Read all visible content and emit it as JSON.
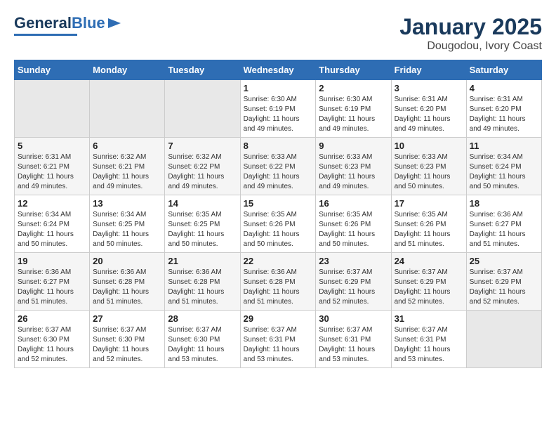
{
  "header": {
    "logo_general": "General",
    "logo_blue": "Blue",
    "title": "January 2025",
    "subtitle": "Dougodou, Ivory Coast"
  },
  "weekdays": [
    "Sunday",
    "Monday",
    "Tuesday",
    "Wednesday",
    "Thursday",
    "Friday",
    "Saturday"
  ],
  "weeks": [
    [
      {
        "day": "",
        "info": ""
      },
      {
        "day": "",
        "info": ""
      },
      {
        "day": "",
        "info": ""
      },
      {
        "day": "1",
        "info": "Sunrise: 6:30 AM\nSunset: 6:19 PM\nDaylight: 11 hours\nand 49 minutes."
      },
      {
        "day": "2",
        "info": "Sunrise: 6:30 AM\nSunset: 6:19 PM\nDaylight: 11 hours\nand 49 minutes."
      },
      {
        "day": "3",
        "info": "Sunrise: 6:31 AM\nSunset: 6:20 PM\nDaylight: 11 hours\nand 49 minutes."
      },
      {
        "day": "4",
        "info": "Sunrise: 6:31 AM\nSunset: 6:20 PM\nDaylight: 11 hours\nand 49 minutes."
      }
    ],
    [
      {
        "day": "5",
        "info": "Sunrise: 6:31 AM\nSunset: 6:21 PM\nDaylight: 11 hours\nand 49 minutes."
      },
      {
        "day": "6",
        "info": "Sunrise: 6:32 AM\nSunset: 6:21 PM\nDaylight: 11 hours\nand 49 minutes."
      },
      {
        "day": "7",
        "info": "Sunrise: 6:32 AM\nSunset: 6:22 PM\nDaylight: 11 hours\nand 49 minutes."
      },
      {
        "day": "8",
        "info": "Sunrise: 6:33 AM\nSunset: 6:22 PM\nDaylight: 11 hours\nand 49 minutes."
      },
      {
        "day": "9",
        "info": "Sunrise: 6:33 AM\nSunset: 6:23 PM\nDaylight: 11 hours\nand 49 minutes."
      },
      {
        "day": "10",
        "info": "Sunrise: 6:33 AM\nSunset: 6:23 PM\nDaylight: 11 hours\nand 50 minutes."
      },
      {
        "day": "11",
        "info": "Sunrise: 6:34 AM\nSunset: 6:24 PM\nDaylight: 11 hours\nand 50 minutes."
      }
    ],
    [
      {
        "day": "12",
        "info": "Sunrise: 6:34 AM\nSunset: 6:24 PM\nDaylight: 11 hours\nand 50 minutes."
      },
      {
        "day": "13",
        "info": "Sunrise: 6:34 AM\nSunset: 6:25 PM\nDaylight: 11 hours\nand 50 minutes."
      },
      {
        "day": "14",
        "info": "Sunrise: 6:35 AM\nSunset: 6:25 PM\nDaylight: 11 hours\nand 50 minutes."
      },
      {
        "day": "15",
        "info": "Sunrise: 6:35 AM\nSunset: 6:26 PM\nDaylight: 11 hours\nand 50 minutes."
      },
      {
        "day": "16",
        "info": "Sunrise: 6:35 AM\nSunset: 6:26 PM\nDaylight: 11 hours\nand 50 minutes."
      },
      {
        "day": "17",
        "info": "Sunrise: 6:35 AM\nSunset: 6:26 PM\nDaylight: 11 hours\nand 51 minutes."
      },
      {
        "day": "18",
        "info": "Sunrise: 6:36 AM\nSunset: 6:27 PM\nDaylight: 11 hours\nand 51 minutes."
      }
    ],
    [
      {
        "day": "19",
        "info": "Sunrise: 6:36 AM\nSunset: 6:27 PM\nDaylight: 11 hours\nand 51 minutes."
      },
      {
        "day": "20",
        "info": "Sunrise: 6:36 AM\nSunset: 6:28 PM\nDaylight: 11 hours\nand 51 minutes."
      },
      {
        "day": "21",
        "info": "Sunrise: 6:36 AM\nSunset: 6:28 PM\nDaylight: 11 hours\nand 51 minutes."
      },
      {
        "day": "22",
        "info": "Sunrise: 6:36 AM\nSunset: 6:28 PM\nDaylight: 11 hours\nand 51 minutes."
      },
      {
        "day": "23",
        "info": "Sunrise: 6:37 AM\nSunset: 6:29 PM\nDaylight: 11 hours\nand 52 minutes."
      },
      {
        "day": "24",
        "info": "Sunrise: 6:37 AM\nSunset: 6:29 PM\nDaylight: 11 hours\nand 52 minutes."
      },
      {
        "day": "25",
        "info": "Sunrise: 6:37 AM\nSunset: 6:29 PM\nDaylight: 11 hours\nand 52 minutes."
      }
    ],
    [
      {
        "day": "26",
        "info": "Sunrise: 6:37 AM\nSunset: 6:30 PM\nDaylight: 11 hours\nand 52 minutes."
      },
      {
        "day": "27",
        "info": "Sunrise: 6:37 AM\nSunset: 6:30 PM\nDaylight: 11 hours\nand 52 minutes."
      },
      {
        "day": "28",
        "info": "Sunrise: 6:37 AM\nSunset: 6:30 PM\nDaylight: 11 hours\nand 53 minutes."
      },
      {
        "day": "29",
        "info": "Sunrise: 6:37 AM\nSunset: 6:31 PM\nDaylight: 11 hours\nand 53 minutes."
      },
      {
        "day": "30",
        "info": "Sunrise: 6:37 AM\nSunset: 6:31 PM\nDaylight: 11 hours\nand 53 minutes."
      },
      {
        "day": "31",
        "info": "Sunrise: 6:37 AM\nSunset: 6:31 PM\nDaylight: 11 hours\nand 53 minutes."
      },
      {
        "day": "",
        "info": ""
      }
    ]
  ]
}
